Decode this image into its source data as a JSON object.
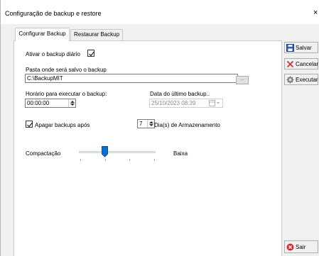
{
  "window": {
    "title": "Configuração de backup e restore",
    "close_glyph": "×"
  },
  "tabs": [
    {
      "label": "Configurar Backup",
      "active": true
    },
    {
      "label": "Restaurar Backup",
      "active": false
    }
  ],
  "config": {
    "daily_backup_label": "Ativar o backup diário",
    "daily_backup_checked": true,
    "folder_label": "Pasta onde será salvo o backup",
    "folder_value": "C:\\BackupMIT",
    "browse_label": "...",
    "time_label": "Horário para executar o backup:",
    "time_value": "00:00:00",
    "last_backup_label": "Data do último backup..",
    "last_backup_value": "25/10/2023 08:39",
    "delete_after_label": "Apagar backups após",
    "delete_after_checked": true,
    "days_value": "7",
    "days_suffix": "Dia(s) de Armazenamento",
    "compression_label": "Compactação",
    "compression_level_label": "Baixa",
    "compression_level": 1,
    "compression_steps": 4
  },
  "buttons": {
    "save": "Salvar",
    "cancel": "Cancelar",
    "execute": "Executar",
    "exit": "Sair"
  },
  "icons": {
    "save": "floppy-disk-icon",
    "cancel": "red-x-icon",
    "execute": "gear-icon",
    "exit": "red-circle-x-icon"
  },
  "colors": {
    "accent": "#0b6fd8",
    "danger": "#d32f2f",
    "save_blue": "#2f5fb3"
  }
}
